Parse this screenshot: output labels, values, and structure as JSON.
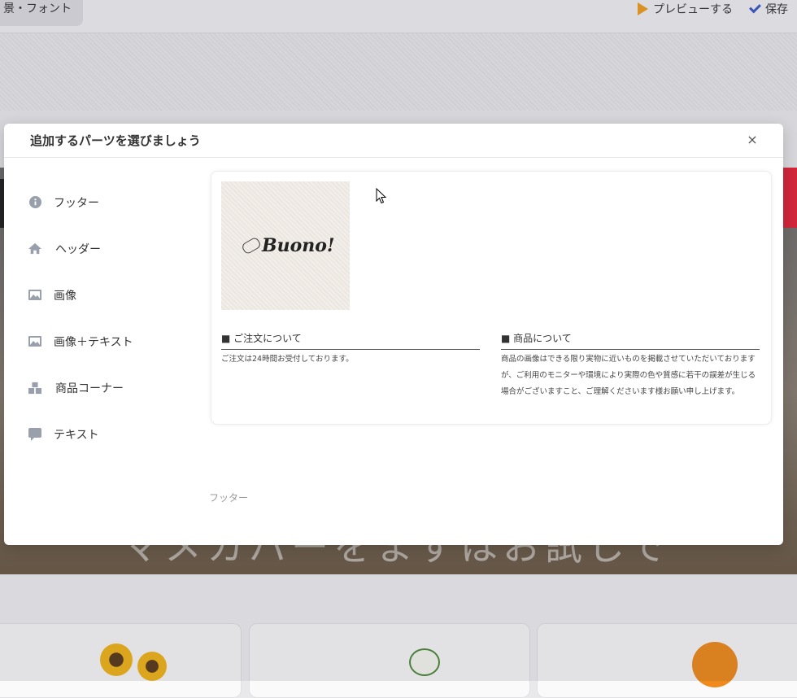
{
  "topbar": {
    "tab_label": "景・フォント",
    "preview_label": "プレビューする",
    "save_label": "保存"
  },
  "background": {
    "catchcopy": "マメカバーをまずはお試しで"
  },
  "modal": {
    "title": "追加するパーツを選びましょう",
    "close_label": "×",
    "menu": [
      {
        "label": "フッター",
        "icon": "info-icon"
      },
      {
        "label": "ヘッダー",
        "icon": "home-icon"
      },
      {
        "label": "画像",
        "icon": "image-icon"
      },
      {
        "label": "画像＋テキスト",
        "icon": "image-icon"
      },
      {
        "label": "商品コーナー",
        "icon": "boxes-icon"
      },
      {
        "label": "テキスト",
        "icon": "speech-bubble-icon"
      }
    ],
    "preview": {
      "logo_text": "Buono!",
      "order_heading": "■ ご注文について",
      "order_body": "ご注文は24時間お受付しております。",
      "product_heading": "■ 商品について",
      "product_body": "商品の画像はできる限り実物に近いものを掲載させていただいておりますが、ご利用のモニターや環境により実際の色や質感に若干の誤差が生じる場合がございますこと、ご理解くださいます様お願い申し上げます。"
    },
    "caption": "フッター"
  },
  "colors": {
    "preview_icon": "#f0a020",
    "save_icon": "#3b58c9",
    "menu_icon": "#9aa0ab",
    "hero_red": "#e8243a"
  }
}
